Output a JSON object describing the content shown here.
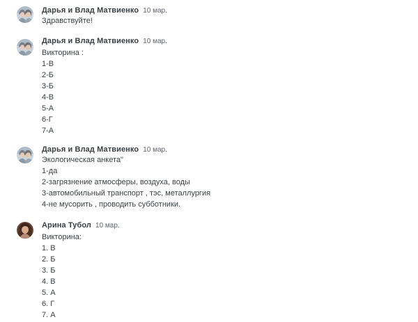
{
  "comments": [
    {
      "author": "Дарья и Влад Матвиенко",
      "date": "10 мар.",
      "lines": [
        "Здравствуйте!"
      ]
    },
    {
      "author": "Дарья и Влад Матвиенко",
      "date": "10 мар.",
      "lines": [
        "Викторина :",
        "1-В",
        "2-Б",
        "3-Б",
        "4-В",
        "5-А",
        "6-Г",
        "7-А"
      ]
    },
    {
      "author": "Дарья и Влад Матвиенко",
      "date": "10 мар.",
      "lines": [
        "Экологическая анкета\"",
        "1-да",
        "2-загрязнение атмосферы, воздуха, воды",
        "3-автомобильный транспорт , тэс, металлургия",
        "4-не мусорить , проводить субботники."
      ]
    },
    {
      "author": "Арина Тубол",
      "date": "10 мар.",
      "lines": [
        "Викторина:",
        "1. В",
        "2. Б",
        "3. Б",
        "4. В",
        "5. А",
        "6. Г",
        "7. А"
      ]
    }
  ]
}
